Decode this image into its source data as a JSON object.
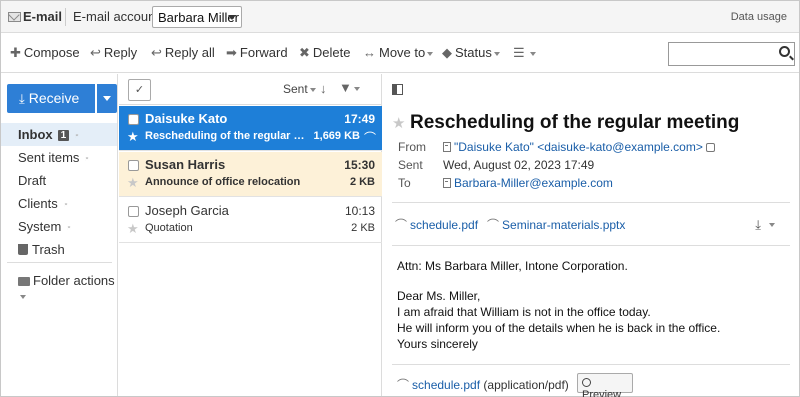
{
  "topbar": {
    "app_title": "E-mail",
    "account_label": "E-mail account:",
    "account_selected": "Barbara Miller",
    "data_usage": "Data usage"
  },
  "toolbar": {
    "compose": "Compose",
    "reply": "Reply",
    "reply_all": "Reply all",
    "forward": "Forward",
    "delete": "Delete",
    "move_to": "Move to",
    "status": "Status",
    "search_value": ""
  },
  "sidebar": {
    "receive_label": "Receive",
    "folders": [
      {
        "label": "Inbox",
        "badge": "1"
      },
      {
        "label": "Sent items"
      },
      {
        "label": "Draft"
      },
      {
        "label": "Clients"
      },
      {
        "label": "System"
      },
      {
        "label": "Trash"
      }
    ],
    "folder_actions": "Folder actions"
  },
  "list": {
    "sort_label": "Sent",
    "messages": [
      {
        "from": "Daisuke Kato",
        "time": "17:49",
        "subject": "Rescheduling of the regular me...",
        "size": "1,669 KB"
      },
      {
        "from": "Susan Harris",
        "time": "15:30",
        "subject": "Announce of office relocation",
        "size": "2 KB"
      },
      {
        "from": "Joseph Garcia",
        "time": "10:13",
        "subject": "Quotation",
        "size": "2 KB"
      }
    ]
  },
  "message": {
    "subject": "Rescheduling of the regular meeting",
    "from_label": "From",
    "from_name": "\"Daisuke Kato\"",
    "from_email": "<daisuke-kato@example.com>",
    "sent_label": "Sent",
    "sent_value": "Wed, August 02, 2023 17:49",
    "to_label": "To",
    "to_value": "Barbara-Miller@example.com",
    "attachments": [
      "schedule.pdf",
      "Seminar-materials.pptx"
    ],
    "body": [
      "Attn: Ms Barbara Miller, Intone Corporation.",
      "Dear Ms. Miller,",
      "I am afraid that William is not in the office today.",
      "He will inform you of the details when he is back in the office.",
      "Yours sincerely"
    ],
    "bottom_attachment_name": "schedule.pdf",
    "bottom_attachment_type": "(application/pdf)",
    "preview_label": "Preview"
  }
}
